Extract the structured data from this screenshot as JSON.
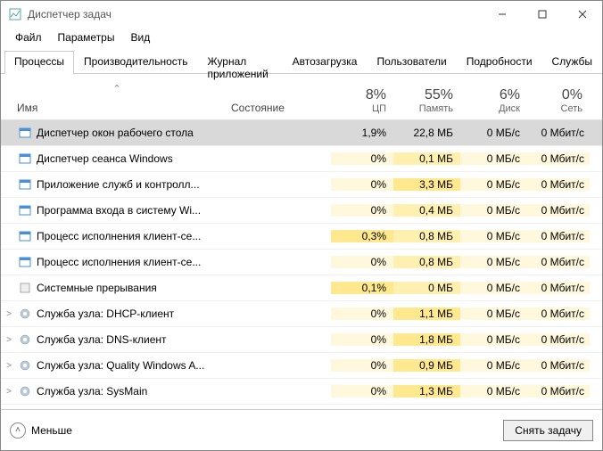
{
  "window": {
    "title": "Диспетчер задач"
  },
  "menu": {
    "file": "Файл",
    "options": "Параметры",
    "view": "Вид"
  },
  "tabs": [
    {
      "label": "Процессы",
      "active": true
    },
    {
      "label": "Производительность"
    },
    {
      "label": "Журнал приложений"
    },
    {
      "label": "Автозагрузка"
    },
    {
      "label": "Пользователи"
    },
    {
      "label": "Подробности"
    },
    {
      "label": "Службы"
    }
  ],
  "columns": {
    "name": "Имя",
    "state": "Состояние",
    "cpu": {
      "pct": "8%",
      "label": "ЦП"
    },
    "mem": {
      "pct": "55%",
      "label": "Память"
    },
    "disk": {
      "pct": "6%",
      "label": "Диск"
    },
    "net": {
      "pct": "0%",
      "label": "Сеть"
    }
  },
  "processes": [
    {
      "icon": "window",
      "name": "Диспетчер окон рабочего стола",
      "cpu": "1,9%",
      "mem": "22,8 МБ",
      "disk": "0 МБ/с",
      "net": "0 Мбит/с",
      "exp": "",
      "selected": true,
      "cpu_heat": 3,
      "mem_heat": 3
    },
    {
      "icon": "window",
      "name": "Диспетчер сеанса  Windows",
      "cpu": "0%",
      "mem": "0,1 МБ",
      "disk": "0 МБ/с",
      "net": "0 Мбит/с",
      "exp": "",
      "cpu_heat": 0,
      "mem_heat": 1
    },
    {
      "icon": "window",
      "name": "Приложение служб и контролл...",
      "cpu": "0%",
      "mem": "3,3 МБ",
      "disk": "0 МБ/с",
      "net": "0 Мбит/с",
      "exp": "",
      "cpu_heat": 0,
      "mem_heat": 2
    },
    {
      "icon": "window",
      "name": "Программа входа в систему Wi...",
      "cpu": "0%",
      "mem": "0,4 МБ",
      "disk": "0 МБ/с",
      "net": "0 Мбит/с",
      "exp": "",
      "cpu_heat": 0,
      "mem_heat": 1
    },
    {
      "icon": "window",
      "name": "Процесс исполнения клиент-се...",
      "cpu": "0,3%",
      "mem": "0,8 МБ",
      "disk": "0 МБ/с",
      "net": "0 Мбит/с",
      "exp": "",
      "cpu_heat": 2,
      "mem_heat": 1
    },
    {
      "icon": "window",
      "name": "Процесс исполнения клиент-се...",
      "cpu": "0%",
      "mem": "0,8 МБ",
      "disk": "0 МБ/с",
      "net": "0 Мбит/с",
      "exp": "",
      "cpu_heat": 0,
      "mem_heat": 1
    },
    {
      "icon": "plain",
      "name": "Системные прерывания",
      "cpu": "0,1%",
      "mem": "0 МБ",
      "disk": "0 МБ/с",
      "net": "0 Мбит/с",
      "exp": "",
      "cpu_heat": 2,
      "mem_heat": 1
    },
    {
      "icon": "gear",
      "name": "Служба узла: DHCP-клиент",
      "cpu": "0%",
      "mem": "1,1 МБ",
      "disk": "0 МБ/с",
      "net": "0 Мбит/с",
      "exp": ">",
      "cpu_heat": 0,
      "mem_heat": 2
    },
    {
      "icon": "gear",
      "name": "Служба узла: DNS-клиент",
      "cpu": "0%",
      "mem": "1,8 МБ",
      "disk": "0 МБ/с",
      "net": "0 Мбит/с",
      "exp": ">",
      "cpu_heat": 0,
      "mem_heat": 2
    },
    {
      "icon": "gear",
      "name": "Служба узла: Quality Windows A...",
      "cpu": "0%",
      "mem": "0,9 МБ",
      "disk": "0 МБ/с",
      "net": "0 Мбит/с",
      "exp": ">",
      "cpu_heat": 0,
      "mem_heat": 2
    },
    {
      "icon": "gear",
      "name": "Служба узла: SysMain",
      "cpu": "0%",
      "mem": "1,3 МБ",
      "disk": "0 МБ/с",
      "net": "0 Мбит/с",
      "exp": ">",
      "cpu_heat": 0,
      "mem_heat": 2
    }
  ],
  "footer": {
    "less": "Меньше",
    "end_task": "Снять задачу"
  },
  "heat": {
    "disk_heat": 0,
    "net_heat": 0
  }
}
